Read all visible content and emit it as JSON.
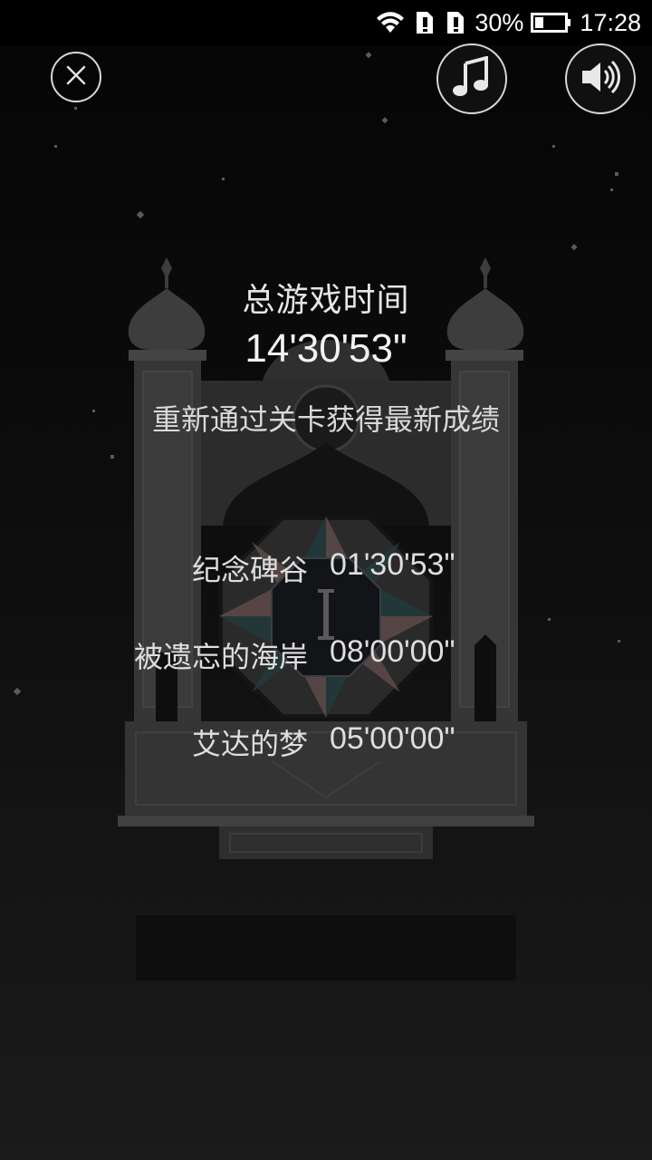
{
  "status_bar": {
    "battery_percent": "30%",
    "time": "17:28",
    "icons": [
      "wifi-icon",
      "sim-alert-icon",
      "sim-alert-icon",
      "battery-icon"
    ]
  },
  "controls": {
    "close": "close-icon",
    "music": "music-note-icon",
    "sound": "speaker-icon"
  },
  "summary": {
    "title": "总游戏时间",
    "total_time": "14'30'53\"",
    "subtitle": "重新通过关卡获得最新成绩"
  },
  "levels": [
    {
      "name": "纪念碑谷",
      "time": "01'30'53\""
    },
    {
      "name": "被遗忘的海岸",
      "time": "08'00'00\""
    },
    {
      "name": "艾达的梦",
      "time": "05'00'00\""
    }
  ],
  "colors": {
    "background": "#0a0a0a",
    "text": "#e6e6e6",
    "monument": "#3a3a3a"
  }
}
